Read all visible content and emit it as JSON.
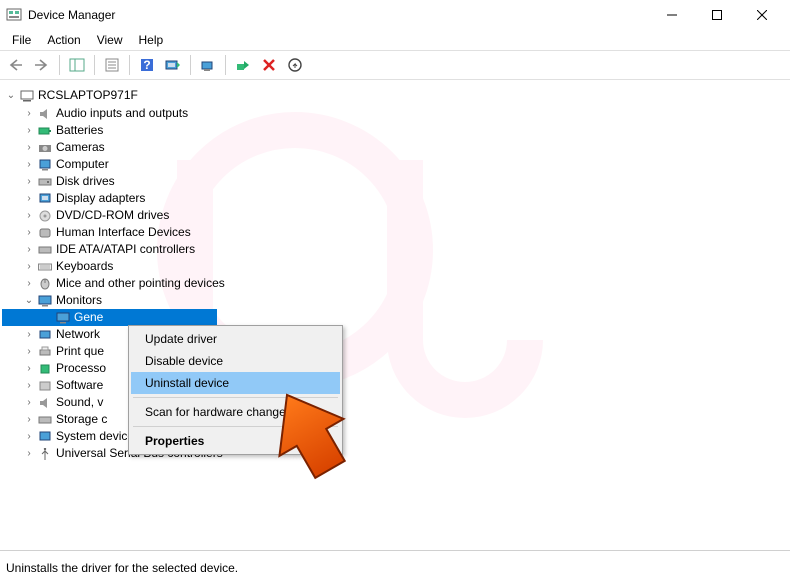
{
  "window": {
    "title": "Device Manager"
  },
  "menubar": {
    "file": "File",
    "action": "Action",
    "view": "View",
    "help": "Help"
  },
  "tree": {
    "root": "RCSLAPTOP971F",
    "audio": "Audio inputs and outputs",
    "batteries": "Batteries",
    "cameras": "Cameras",
    "computer": "Computer",
    "diskdrives": "Disk drives",
    "display": "Display adapters",
    "dvd": "DVD/CD-ROM drives",
    "hid": "Human Interface Devices",
    "ide": "IDE ATA/ATAPI controllers",
    "keyboards": "Keyboards",
    "mice": "Mice and other pointing devices",
    "monitors": "Monitors",
    "monitor_child": "Gene",
    "network": "Network",
    "printq": "Print que",
    "processors": "Processo",
    "software": "Software",
    "sound": "Sound, v",
    "storage": "Storage c",
    "system": "System devices",
    "usb": "Universal Serial Bus controllers"
  },
  "contextmenu": {
    "update": "Update driver",
    "disable": "Disable device",
    "uninstall": "Uninstall device",
    "scan": "Scan for hardware changes",
    "properties": "Properties"
  },
  "statusbar": {
    "text": "Uninstalls the driver for the selected device."
  },
  "colors": {
    "selection": "#0078d4",
    "context_highlight": "#91c9f7",
    "arrow_fill": "#ff5a00"
  }
}
